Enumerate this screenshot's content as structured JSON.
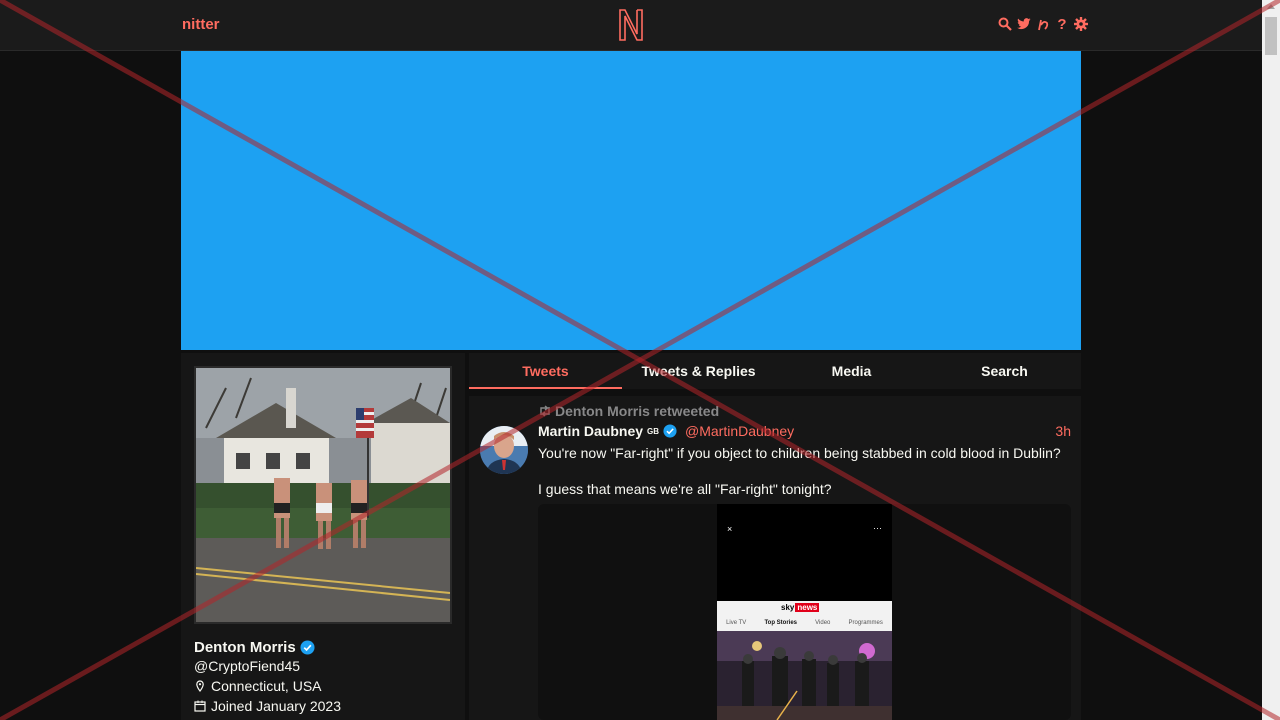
{
  "navbar": {
    "site_name": "nitter",
    "logo_letter": "N",
    "icons": [
      "search-icon",
      "twitter-icon",
      "rss-icon",
      "help-icon",
      "settings-icon"
    ],
    "help_glyph": "?",
    "accent": "#ff6c60"
  },
  "banner": {
    "color": "#1da1f2"
  },
  "profile": {
    "name": "Denton Morris",
    "handle": "@CryptoFiend45",
    "location": "Connecticut, USA",
    "joined": "Joined January 2023"
  },
  "tabs": [
    {
      "label": "Tweets",
      "active": true
    },
    {
      "label": "Tweets & Replies",
      "active": false
    },
    {
      "label": "Media",
      "active": false
    },
    {
      "label": "Search",
      "active": false
    }
  ],
  "tweet": {
    "retweet_label": "Denton Morris retweeted",
    "author_name": "Martin Daubney",
    "author_flag": "GB",
    "author_handle": "@MartinDaubney",
    "time": "3h",
    "text_line1": "You're now \"Far-right\" if you object to children being stabbed in cold blood in Dublin?",
    "text_line2": "I guess that means we're all \"Far-right\" tonight?",
    "media": {
      "close_glyph": "×",
      "more_glyph": "···",
      "app_brand_1": "sky",
      "app_brand_2": "news",
      "app_nav": [
        "Live TV",
        "Top Stories",
        "Video",
        "Programmes"
      ],
      "app_nav_active": "Top Stories"
    }
  }
}
